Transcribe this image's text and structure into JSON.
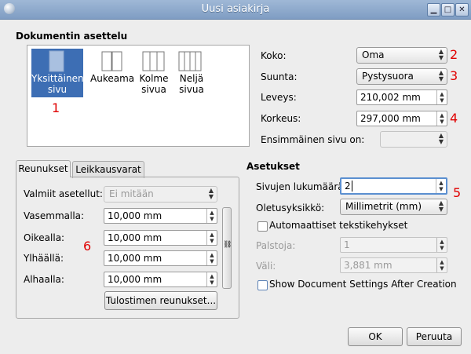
{
  "window": {
    "title": "Uusi asiakirja"
  },
  "layout_section": {
    "heading": "Dokumentin asettelu",
    "options": [
      {
        "line1": "Yksittäinen",
        "line2": "sivu",
        "selected": true
      },
      {
        "line1": "Aukeama",
        "line2": "",
        "selected": false
      },
      {
        "line1": "Kolme",
        "line2": "sivua",
        "selected": false
      },
      {
        "line1": "Neljä",
        "line2": "sivua",
        "selected": false
      }
    ]
  },
  "page_settings": {
    "size_label": "Koko:",
    "size_value": "Oma",
    "orientation_label": "Suunta:",
    "orientation_value": "Pystysuora",
    "width_label": "Leveys:",
    "width_value": "210,002 mm",
    "height_label": "Korkeus:",
    "height_value": "297,000 mm",
    "first_page_label": "Ensimmäinen sivu on:",
    "first_page_value": ""
  },
  "tabs": {
    "margins": "Reunukset",
    "bleeds": "Leikkausvarat"
  },
  "margins": {
    "presets_label": "Valmiit asetellut:",
    "presets_value": "Ei mitään",
    "left_label": "Vasemmalla:",
    "left_value": "10,000 mm",
    "right_label": "Oikealla:",
    "right_value": "10,000 mm",
    "top_label": "Ylhäällä:",
    "top_value": "10,000 mm",
    "bottom_label": "Alhaalla:",
    "bottom_value": "10,000 mm",
    "printer_button": "Tulostimen reunukset..."
  },
  "settings": {
    "heading": "Asetukset",
    "page_count_label": "Sivujen lukumäärä:",
    "page_count_value": "2",
    "unit_label": "Oletusyksikkö:",
    "unit_value": "Millimetrit (mm)",
    "auto_frames_label": "Automaattiset tekstikehykset",
    "columns_label": "Palstoja:",
    "columns_value": "1",
    "gap_label": "Väli:",
    "gap_value": "3,881 mm",
    "show_settings_label": "Show Document Settings After Creation"
  },
  "buttons": {
    "ok": "OK",
    "cancel": "Peruuta"
  },
  "annotations": {
    "n1": "1",
    "n2": "2",
    "n3": "3",
    "n4": "4",
    "n5": "5",
    "n6": "6"
  },
  "colors": {
    "accent": "#3d6eb4",
    "marker": "#e00000"
  }
}
